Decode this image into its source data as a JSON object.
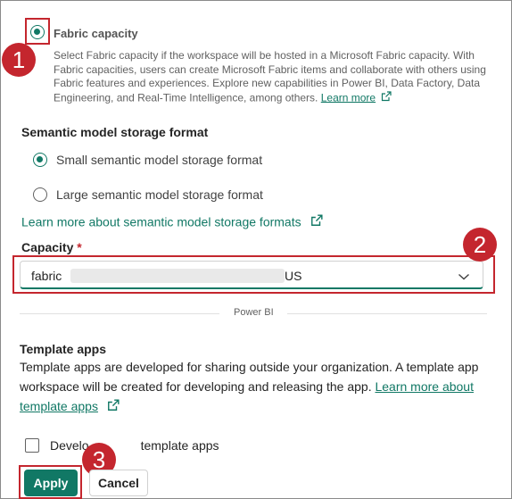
{
  "fabric": {
    "title": "Fabric capacity",
    "description_line1": "Select Fabric capacity if the workspace will be hosted in a Microsoft Fabric capacity. With",
    "description_line2": "Fabric capacities, users can create Microsoft Fabric items and collaborate with others using",
    "description_line3": "Fabric features and experiences. Explore new capabilities in Power BI, Data Factory, Data",
    "description_line4": "Engineering, and Real-Time Intelligence, among others.",
    "learn_more": "Learn more",
    "selected": true
  },
  "storage": {
    "title": "Semantic model storage format",
    "option_small": "Small semantic model storage format",
    "option_large": "Large semantic model storage format",
    "selected": "small",
    "learn_more": "Learn more about semantic model storage formats"
  },
  "capacity": {
    "label": "Capacity",
    "required_marker": "*",
    "value_prefix": "fabric",
    "value_suffix": "US"
  },
  "divider": {
    "label": "Power BI"
  },
  "template_apps": {
    "title": "Template apps",
    "line1": "Template apps are developed for sharing outside your organization. A template app",
    "line2": "workspace will be created for developing and releasing the app.",
    "learn_more_part1": "Learn more about",
    "learn_more_part2": "template apps",
    "checkbox_label_part1": "Develo",
    "checkbox_label_part2": "template apps",
    "checked": false
  },
  "buttons": {
    "apply": "Apply",
    "cancel": "Cancel"
  },
  "annotations": {
    "step1": "1",
    "step2": "2",
    "step3": "3"
  },
  "colors": {
    "accent": "#117865",
    "callout": "#c4262e"
  }
}
